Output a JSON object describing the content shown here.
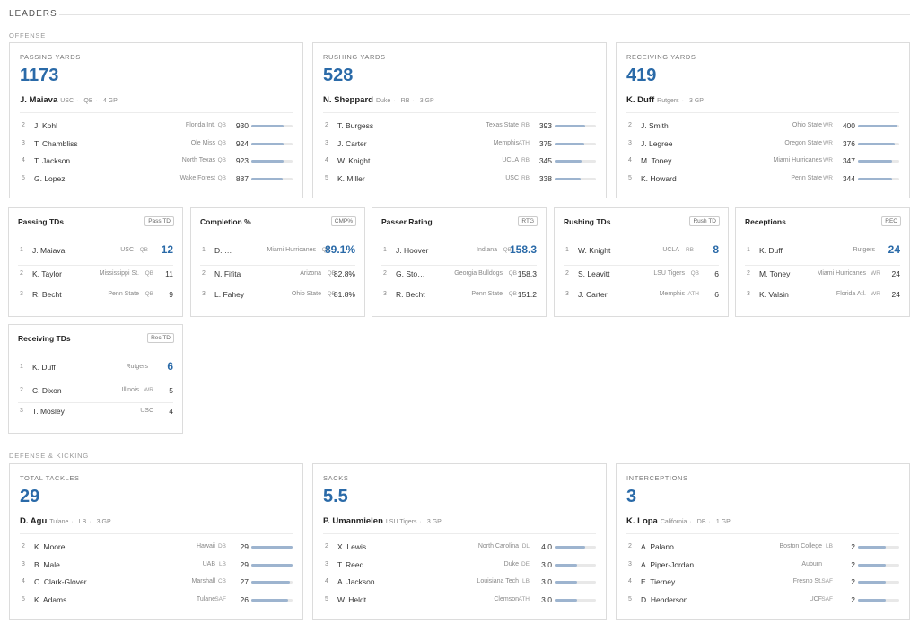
{
  "header": {
    "title": "LEADERS"
  },
  "sections": {
    "offense": "OFFENSE",
    "defense": "DEFENSE & KICKING"
  },
  "colors": {
    "accent": "#2a6aa8",
    "bar": "#9db4cf"
  },
  "offense_big": [
    {
      "category": "PASSING YARDS",
      "value": "1173",
      "leader": {
        "name": "J. Maiava",
        "team": "USC",
        "pos": "QB",
        "gp": "4 GP"
      },
      "rows": [
        {
          "rank": "2",
          "name": "J. Kohl",
          "team": "Florida Int.",
          "pos": "QB",
          "value": "930",
          "pct": 0.79
        },
        {
          "rank": "3",
          "name": "T. Chambliss",
          "team": "Ole Miss",
          "pos": "QB",
          "value": "924",
          "pct": 0.79
        },
        {
          "rank": "4",
          "name": "T. Jackson",
          "team": "North Texas",
          "pos": "QB",
          "value": "923",
          "pct": 0.79
        },
        {
          "rank": "5",
          "name": "G. Lopez",
          "team": "Wake Forest",
          "pos": "QB",
          "value": "887",
          "pct": 0.76
        }
      ]
    },
    {
      "category": "RUSHING YARDS",
      "value": "528",
      "leader": {
        "name": "N. Sheppard",
        "team": "Duke",
        "pos": "RB",
        "gp": "3 GP"
      },
      "rows": [
        {
          "rank": "2",
          "name": "T. Burgess",
          "team": "Texas State",
          "pos": "RB",
          "value": "393",
          "pct": 0.74
        },
        {
          "rank": "3",
          "name": "J. Carter",
          "team": "Memphis",
          "pos": "ATH",
          "value": "375",
          "pct": 0.71
        },
        {
          "rank": "4",
          "name": "W. Knight",
          "team": "UCLA",
          "pos": "RB",
          "value": "345",
          "pct": 0.65
        },
        {
          "rank": "5",
          "name": "K. Miller",
          "team": "USC",
          "pos": "RB",
          "value": "338",
          "pct": 0.64
        }
      ]
    },
    {
      "category": "RECEIVING YARDS",
      "value": "419",
      "leader": {
        "name": "K. Duff",
        "team": "Rutgers",
        "pos": "",
        "gp": "3 GP"
      },
      "rows": [
        {
          "rank": "2",
          "name": "J. Smith",
          "team": "Ohio State",
          "pos": "WR",
          "value": "400",
          "pct": 0.95
        },
        {
          "rank": "3",
          "name": "J. Legree",
          "team": "Oregon State",
          "pos": "WR",
          "value": "376",
          "pct": 0.9
        },
        {
          "rank": "4",
          "name": "M. Toney",
          "team": "Miami Hurricanes",
          "pos": "WR",
          "value": "347",
          "pct": 0.83
        },
        {
          "rank": "5",
          "name": "K. Howard",
          "team": "Penn State",
          "pos": "WR",
          "value": "344",
          "pct": 0.82
        }
      ]
    }
  ],
  "offense_small": [
    {
      "title": "Passing TDs",
      "badge": "Pass TD",
      "rows": [
        {
          "rank": "1",
          "name": "J. Maiava",
          "team": "USC",
          "pos": "QB",
          "value": "12"
        },
        {
          "rank": "2",
          "name": "K. Taylor",
          "team": "Mississippi St.",
          "pos": "QB",
          "value": "11"
        },
        {
          "rank": "3",
          "name": "R. Becht",
          "team": "Penn State",
          "pos": "QB",
          "value": "9"
        }
      ]
    },
    {
      "title": "Completion %",
      "badge": "CMP%",
      "rows": [
        {
          "rank": "1",
          "name": "D. …",
          "team": "Miami Hurricanes",
          "pos": "QB",
          "value": "89.1%"
        },
        {
          "rank": "2",
          "name": "N. Fifita",
          "team": "Arizona",
          "pos": "QB",
          "value": "82.8%"
        },
        {
          "rank": "3",
          "name": "L. Fahey",
          "team": "Ohio State",
          "pos": "QB",
          "value": "81.8%"
        }
      ]
    },
    {
      "title": "Passer Rating",
      "badge": "RTG",
      "rows": [
        {
          "rank": "1",
          "name": "J. Hoover",
          "team": "Indiana",
          "pos": "QB",
          "value": "158.3"
        },
        {
          "rank": "2",
          "name": "G. Sto…",
          "team": "Georgia Bulldogs",
          "pos": "QB",
          "value": "158.3"
        },
        {
          "rank": "3",
          "name": "R. Becht",
          "team": "Penn State",
          "pos": "QB",
          "value": "151.2"
        }
      ]
    },
    {
      "title": "Rushing TDs",
      "badge": "Rush TD",
      "rows": [
        {
          "rank": "1",
          "name": "W. Knight",
          "team": "UCLA",
          "pos": "RB",
          "value": "8"
        },
        {
          "rank": "2",
          "name": "S. Leavitt",
          "team": "LSU Tigers",
          "pos": "QB",
          "value": "6"
        },
        {
          "rank": "3",
          "name": "J. Carter",
          "team": "Memphis",
          "pos": "ATH",
          "value": "6"
        }
      ]
    },
    {
      "title": "Receptions",
      "badge": "REC",
      "rows": [
        {
          "rank": "1",
          "name": "K. Duff",
          "team": "Rutgers",
          "pos": "",
          "value": "24"
        },
        {
          "rank": "2",
          "name": "M. Toney",
          "team": "Miami Hurricanes",
          "pos": "WR",
          "value": "24"
        },
        {
          "rank": "3",
          "name": "K. Valsin",
          "team": "Florida Atl.",
          "pos": "WR",
          "value": "24"
        }
      ]
    },
    {
      "title": "Receiving TDs",
      "badge": "Rec TD",
      "rows": [
        {
          "rank": "1",
          "name": "K. Duff",
          "team": "Rutgers",
          "pos": "",
          "value": "6"
        },
        {
          "rank": "2",
          "name": "C. Dixon",
          "team": "Illinois",
          "pos": "WR",
          "value": "5"
        },
        {
          "rank": "3",
          "name": "T. Mosley",
          "team": "USC",
          "pos": "",
          "value": "4"
        }
      ]
    }
  ],
  "defense_big": [
    {
      "category": "TOTAL TACKLES",
      "value": "29",
      "leader": {
        "name": "D. Agu",
        "team": "Tulane",
        "pos": "LB",
        "gp": "3 GP"
      },
      "rows": [
        {
          "rank": "2",
          "name": "K. Moore",
          "team": "Hawaii",
          "pos": "DB",
          "value": "29",
          "pct": 1.0
        },
        {
          "rank": "3",
          "name": "B. Male",
          "team": "UAB",
          "pos": "LB",
          "value": "29",
          "pct": 1.0
        },
        {
          "rank": "4",
          "name": "C. Clark-Glover",
          "team": "Marshall",
          "pos": "CB",
          "value": "27",
          "pct": 0.93
        },
        {
          "rank": "5",
          "name": "K. Adams",
          "team": "Tulane",
          "pos": "SAF",
          "value": "26",
          "pct": 0.9
        }
      ]
    },
    {
      "category": "SACKS",
      "value": "5.5",
      "leader": {
        "name": "P. Umanmielen",
        "team": "LSU Tigers",
        "pos": "",
        "gp": "3 GP"
      },
      "rows": [
        {
          "rank": "2",
          "name": "X. Lewis",
          "team": "North Carolina",
          "pos": "DL",
          "value": "4.0",
          "pct": 0.73
        },
        {
          "rank": "3",
          "name": "T. Reed",
          "team": "Duke",
          "pos": "DE",
          "value": "3.0",
          "pct": 0.55
        },
        {
          "rank": "4",
          "name": "A. Jackson",
          "team": "Louisiana Tech",
          "pos": "LB",
          "value": "3.0",
          "pct": 0.55
        },
        {
          "rank": "5",
          "name": "W. Heldt",
          "team": "Clemson",
          "pos": "ATH",
          "value": "3.0",
          "pct": 0.55
        }
      ]
    },
    {
      "category": "INTERCEPTIONS",
      "value": "3",
      "leader": {
        "name": "K. Lopa",
        "team": "California",
        "pos": "DB",
        "gp": "1 GP"
      },
      "rows": [
        {
          "rank": "2",
          "name": "A. Palano",
          "team": "Boston College",
          "pos": "LB",
          "value": "2",
          "pct": 0.67
        },
        {
          "rank": "3",
          "name": "A. Piper-Jordan",
          "team": "Auburn",
          "pos": "",
          "value": "2",
          "pct": 0.67
        },
        {
          "rank": "4",
          "name": "E. Tierney",
          "team": "Fresno St.",
          "pos": "SAF",
          "value": "2",
          "pct": 0.67
        },
        {
          "rank": "5",
          "name": "D. Henderson",
          "team": "UCF",
          "pos": "SAF",
          "value": "2",
          "pct": 0.67
        }
      ]
    }
  ]
}
